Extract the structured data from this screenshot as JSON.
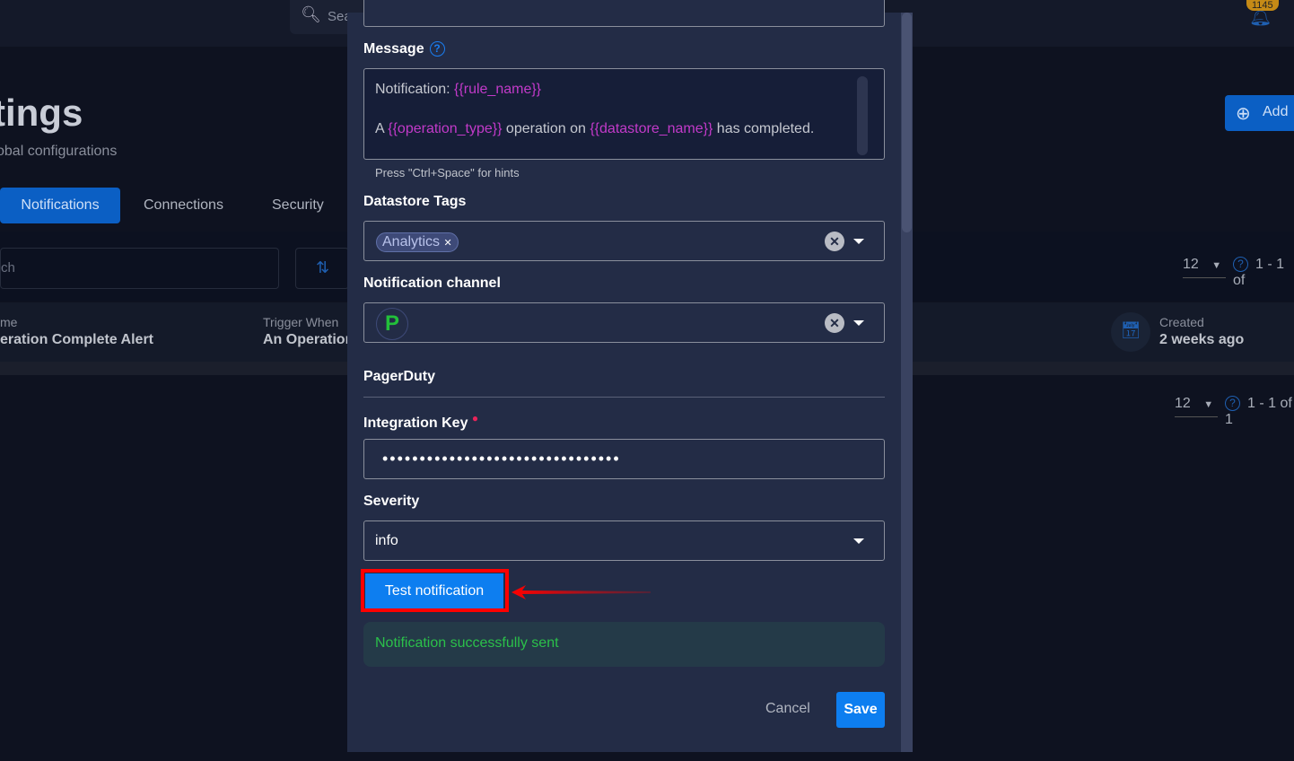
{
  "header": {
    "search_placeholder": "Sea",
    "notification_count": "1145"
  },
  "page": {
    "title": "tings",
    "subtitle": "obal configurations",
    "add_button": "Add"
  },
  "tabs": [
    {
      "label": "Notifications",
      "active": true
    },
    {
      "label": "Connections"
    },
    {
      "label": "Security"
    }
  ],
  "toolbar": {
    "search_placeholder": "ch",
    "page_size": "12",
    "range": "1 - 1 of"
  },
  "table": {
    "row": {
      "name_label": "me",
      "name_value": "eration Complete Alert",
      "trigger_label": "Trigger When",
      "trigger_value": "An Operation",
      "created_label": "Created",
      "created_value": "2 weeks ago"
    }
  },
  "footer_pagination": {
    "page_size": "12",
    "range": "1 - 1 of 1"
  },
  "modal": {
    "message_label": "Message",
    "message": {
      "line1_prefix": "Notification: ",
      "line1_var": "{{rule_name}}",
      "line2_prefix": "A ",
      "line2_var1": "{{operation_type}}",
      "line2_mid": " operation on ",
      "line2_var2": "{{datastore_name}}",
      "line2_suffix": " has completed."
    },
    "hint": "Press \"Ctrl+Space\" for hints",
    "tags_label": "Datastore Tags",
    "tags": [
      "Analytics"
    ],
    "channel_label": "Notification channel",
    "channel_icon": "pagerduty-logo",
    "section_title": "PagerDuty",
    "integration_key_label": "Integration Key",
    "integration_key_value": "••••••••••••••••••••••••••••••••",
    "severity_label": "Severity",
    "severity_value": "info",
    "test_button": "Test notification",
    "success_message": "Notification successfully sent",
    "cancel_button": "Cancel",
    "save_button": "Save"
  },
  "colors": {
    "accent": "#0d7ef0",
    "success": "#2bc04a",
    "placeholder_var": "#c23ac9",
    "annotation": "#ff0000"
  }
}
